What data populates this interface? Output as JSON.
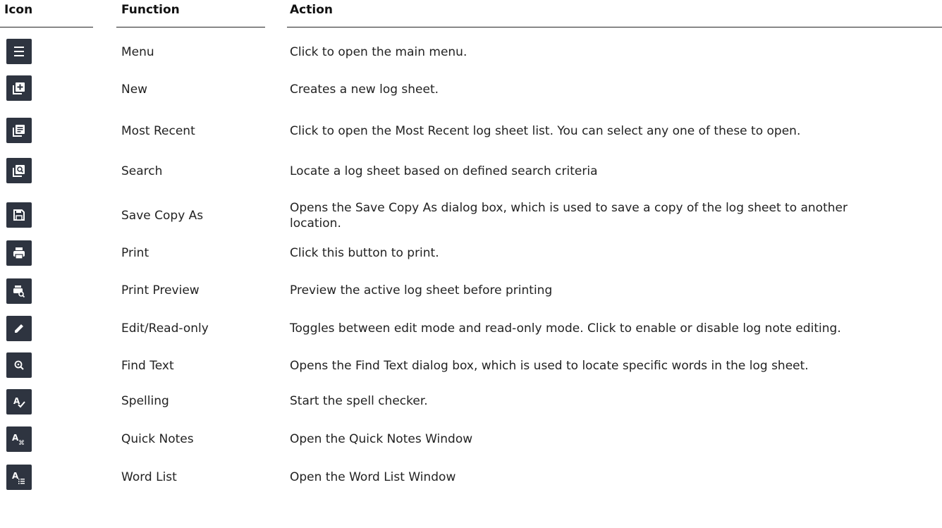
{
  "headers": {
    "icon": "Icon",
    "function": "Function",
    "action": "Action"
  },
  "rows": [
    {
      "icon": "menu-icon",
      "function": "Menu",
      "action": "Click to open the main menu."
    },
    {
      "icon": "new-icon",
      "function": "New",
      "action": "Creates a new log sheet."
    },
    {
      "icon": "most-recent-icon",
      "function": "Most Recent",
      "action": "Click to open the Most Recent log sheet list.  You can select any one of these to open."
    },
    {
      "icon": "search-icon",
      "function": "Search",
      "action": "Locate a log sheet based on defined search criteria"
    },
    {
      "icon": "save-icon",
      "function": "Save Copy As",
      "action_line1": "Opens the Save Copy As dialog box, which is used to save a copy of the log sheet to another",
      "action_line2": "location."
    },
    {
      "icon": "print-icon",
      "function": "Print",
      "action": "Click this button to print."
    },
    {
      "icon": "print-preview-icon",
      "function": "Print Preview",
      "action": "Preview the active log sheet before printing"
    },
    {
      "icon": "pencil-icon",
      "function": "Edit/Read-only",
      "action": "Toggles between edit mode and read-only mode.  Click to enable or disable log note editing."
    },
    {
      "icon": "find-text-icon",
      "function": "Find Text",
      "action": "Opens the Find Text dialog box, which is used to locate specific words in the log sheet."
    },
    {
      "icon": "spelling-icon",
      "function": "Spelling",
      "action": "Start the spell checker."
    },
    {
      "icon": "quick-notes-icon",
      "function": "Quick Notes",
      "action": "Open the Quick Notes Window"
    },
    {
      "icon": "word-list-icon",
      "function": "Word List",
      "action": "Open the Word List Window"
    }
  ],
  "colors": {
    "icon_background": "#2e3440",
    "icon_foreground": "#ffffff",
    "text": "#222222"
  }
}
